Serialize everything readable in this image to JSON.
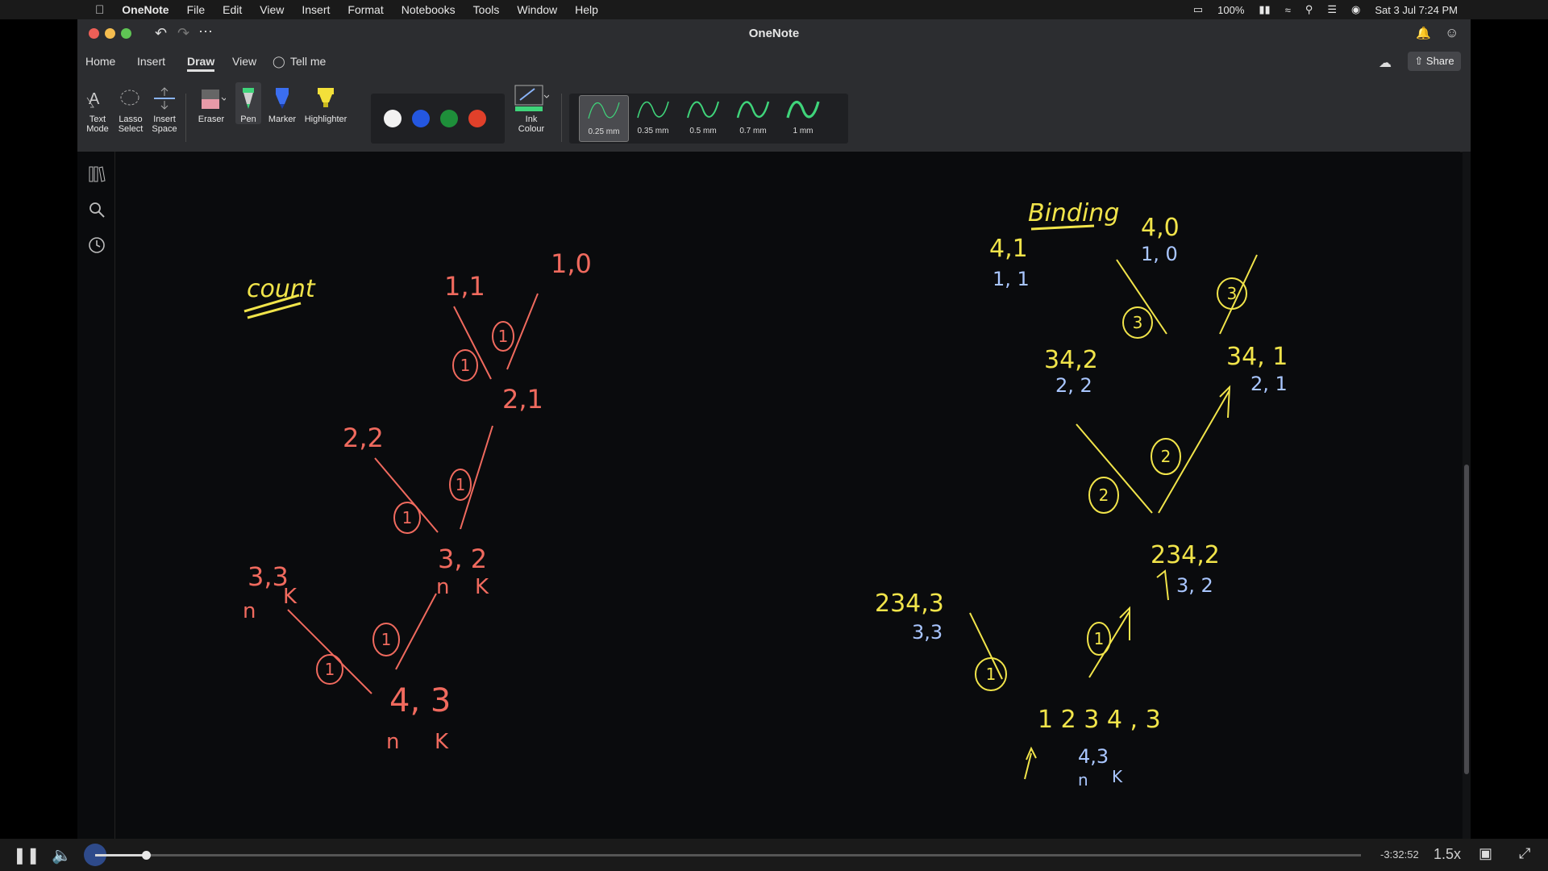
{
  "menubar": {
    "app_name": "OneNote",
    "items": [
      "File",
      "Edit",
      "View",
      "Insert",
      "Format",
      "Notebooks",
      "Tools",
      "Window",
      "Help"
    ],
    "battery": "100%",
    "datetime": "Sat 3 Jul  7:24 PM"
  },
  "window": {
    "title": "OneNote",
    "tabs": [
      "Home",
      "Insert",
      "Draw",
      "View"
    ],
    "active_tab": "Draw",
    "tell_me": "Tell me",
    "share_label": "Share"
  },
  "ribbon": {
    "tools": {
      "text_mode": "Text\nMode",
      "lasso_select": "Lasso\nSelect",
      "insert_space": "Insert\nSpace",
      "eraser": "Eraser",
      "pen": "Pen",
      "marker": "Marker",
      "highlighter": "Highlighter",
      "ink_colour": "Ink\nColour"
    },
    "colors": [
      "#f2f2f2",
      "#2457e0",
      "#1e8f3a",
      "#e0402a"
    ],
    "pen_sizes": [
      "0.25 mm",
      "0.35 mm",
      "0.5 mm",
      "0.7 mm",
      "1 mm"
    ],
    "selected_pen_size": "0.25 mm"
  },
  "canvas": {
    "left_tree": {
      "title": "count",
      "nodes": {
        "n11": "1,1",
        "n10": "1,0",
        "n21": "2,1",
        "n22": "2,2",
        "n32": "3, 2",
        "n33": "3,3",
        "n43": "4, 3",
        "n_label": "n",
        "k_label": "K"
      },
      "edge_cost": "1"
    },
    "right_tree": {
      "title": "Binding",
      "nodes": {
        "a": "4,1",
        "a_sub": "1, 1",
        "b": "4,0",
        "b_sub": "1, 0",
        "c": "34,2",
        "c_sub": "2, 2",
        "d": "34, 1",
        "d_sub": "2, 1",
        "e": "234,3",
        "e_sub": "3,3",
        "f": "234,2",
        "f_sub": "3, 2",
        "root": "1 2 3 4 ,  3",
        "root_sub": "4,3",
        "n_label": "n",
        "k_label": "K"
      },
      "edge_costs": [
        "3",
        "3",
        "2",
        "2",
        "1",
        "1"
      ]
    }
  },
  "video": {
    "time_remaining": "-3:32:52",
    "speed": "1.5x",
    "progress": 0.04
  },
  "theme": {
    "red_ink": "#f06a5e",
    "yellow_ink": "#f1e44a",
    "blue_ink": "#a9c6ff"
  }
}
